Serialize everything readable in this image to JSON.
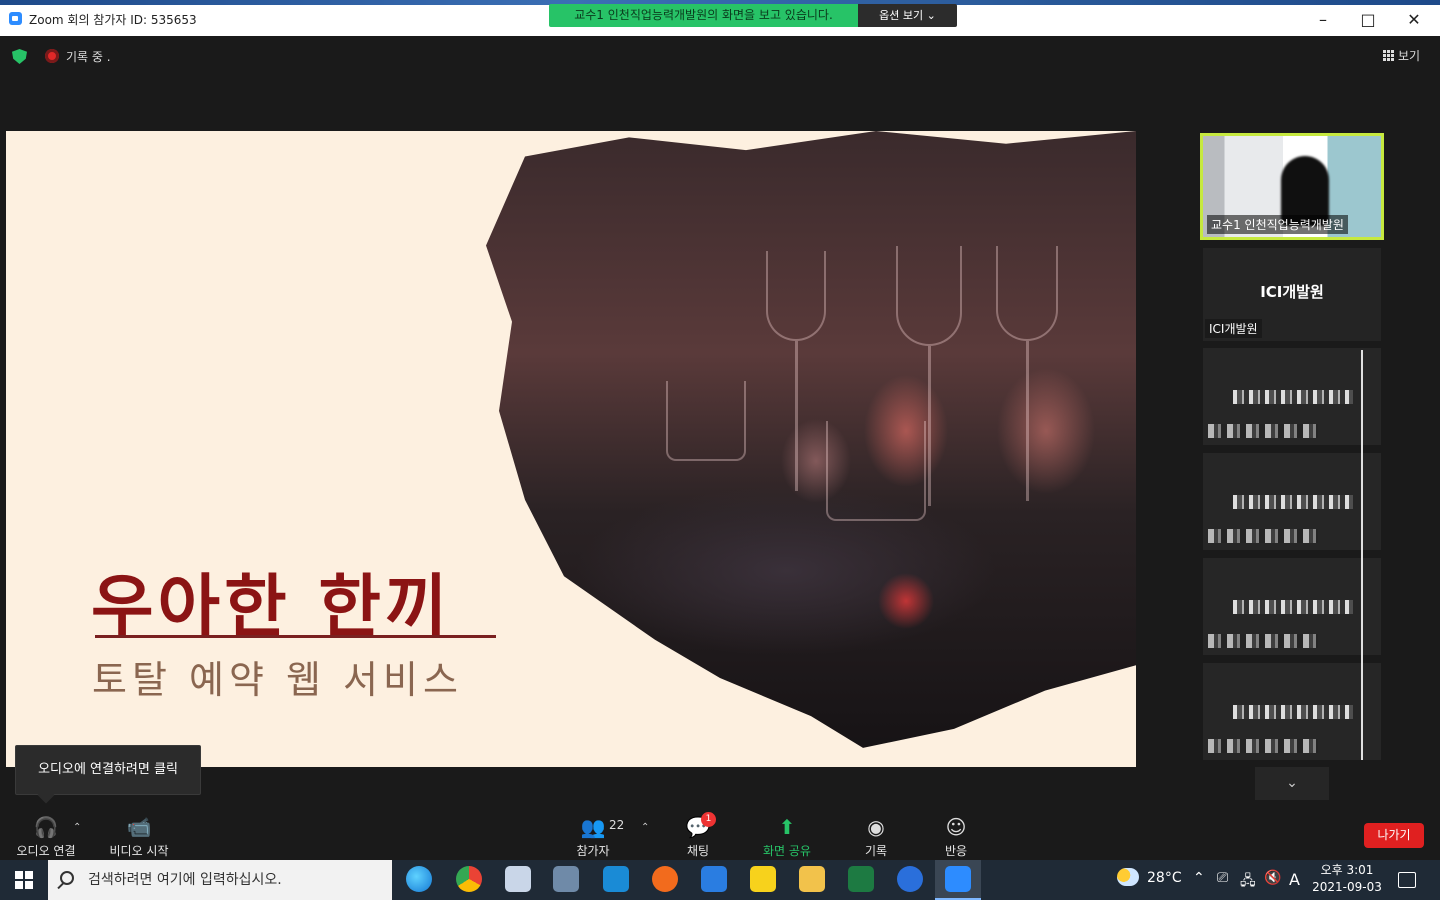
{
  "window": {
    "title": "Zoom 회의 참가자 ID: 535653",
    "minimize": "–",
    "maximize": "□",
    "close": "✕"
  },
  "share_banner": {
    "text": "교수1 인천직업능력개발원의 화면을 보고 있습니다.",
    "options_label": "옵션 보기 ⌄"
  },
  "status": {
    "recording_label": "기록 중 .",
    "view_label": "보기"
  },
  "slide": {
    "title": "우아한 한끼",
    "subtitle": "토탈 예약 웹 서비스"
  },
  "tooltip": {
    "text": "오디오에 연결하려면 클릭"
  },
  "participants_panel": {
    "self_caption": "교수1 인천직업능력개발원",
    "name_tile_big": "ICI개발원",
    "name_tile_small": "ICI개발원",
    "scroll_down": "⌄"
  },
  "toolbar": {
    "audio_label": "오디오 연결",
    "video_label": "비디오 시작",
    "participants_label": "참가자",
    "participants_count": "22",
    "chat_label": "채팅",
    "chat_badge": "1",
    "share_label": "화면 공유",
    "record_label": "기록",
    "reaction_label": "반응",
    "leave_label": "나가기",
    "caret": "⌃"
  },
  "taskbar": {
    "search_placeholder": "검색하려면 여기에 입력하십시오.",
    "weather": "28°C",
    "ime": "A",
    "time": "오후 3:01",
    "date": "2021-09-03"
  },
  "colors": {
    "share_green": "#27c367",
    "leave_red": "#e02020",
    "slide_title": "#8b1414",
    "self_border": "#c6e93f"
  }
}
